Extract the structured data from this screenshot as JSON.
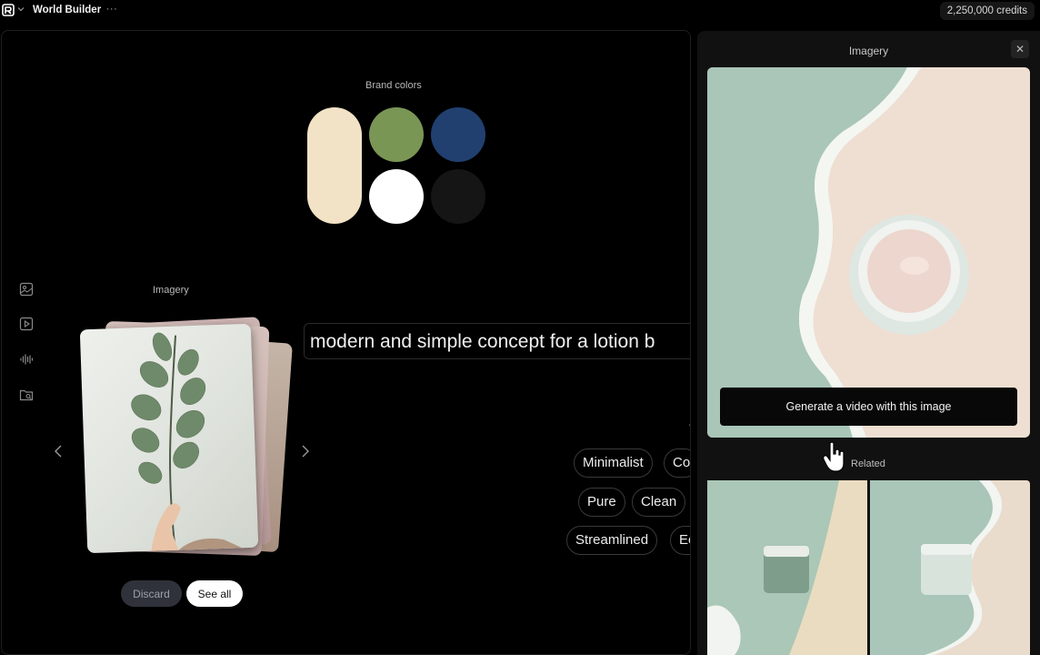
{
  "topbar": {
    "app_title": "World Builder",
    "more_label": "···",
    "credits": "2,250,000 credits"
  },
  "canvas": {
    "brand_colors_label": "Brand colors",
    "brand_colors": [
      "#f2e2c6",
      "#7a9655",
      "#214070",
      "#ffffff",
      "#151515"
    ],
    "imagery_label": "Imagery",
    "prompt_text": "modern and simple concept for a lotion b",
    "keyword_chips": [
      "Minimalist",
      "Co",
      "Pure",
      "Clean",
      "Streamlined",
      "Ec"
    ],
    "discard_label": "Discard",
    "see_all_label": "See all",
    "fragment_text": "V"
  },
  "panel": {
    "title": "Imagery",
    "close_label": "✕",
    "generate_video_label": "Generate a video with this image",
    "related_label": "Related"
  },
  "icons": {
    "tools": [
      "image-icon",
      "video-icon",
      "audio-icon",
      "folder-search-icon"
    ],
    "carousel": [
      "chevron-left-icon",
      "chevron-right-icon"
    ]
  }
}
